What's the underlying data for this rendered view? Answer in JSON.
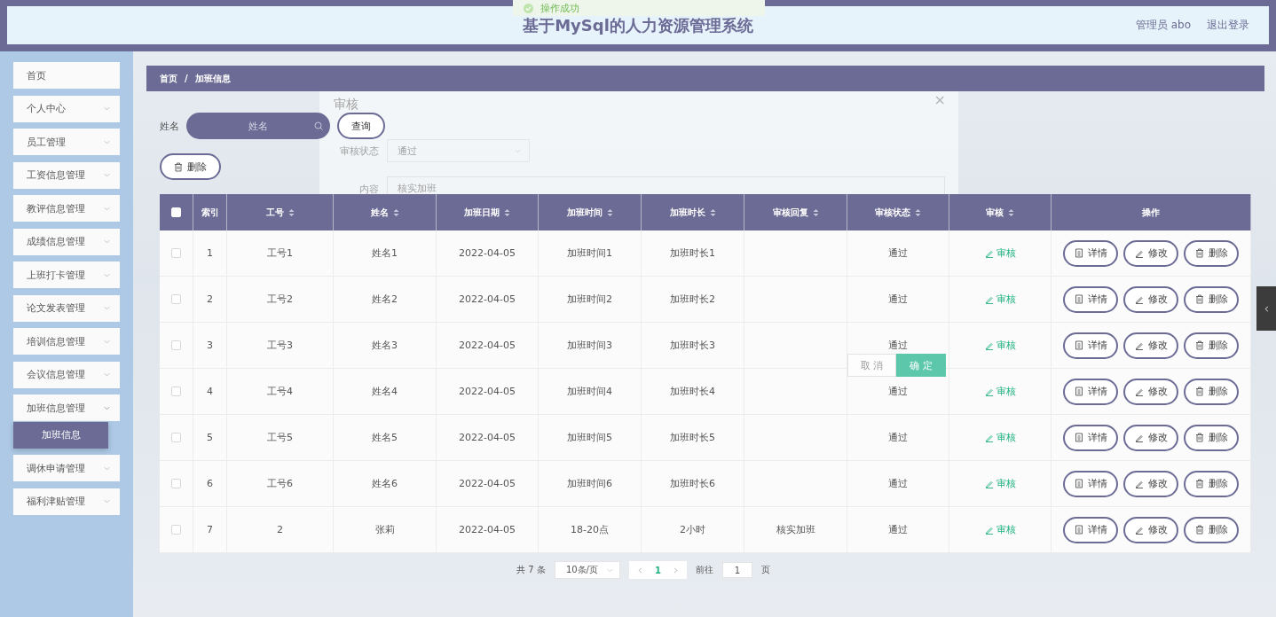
{
  "header": {
    "title": "基于MySql的人力资源管理系统",
    "user": "管理员 abo",
    "logout": "退出登录"
  },
  "toast": {
    "text": "操作成功"
  },
  "sidebar": {
    "items": [
      {
        "label": "首页",
        "expandable": false
      },
      {
        "label": "个人中心",
        "expandable": true,
        "expanded": false
      },
      {
        "label": "员工管理",
        "expandable": true,
        "expanded": false
      },
      {
        "label": "工资信息管理",
        "expandable": true,
        "expanded": false
      },
      {
        "label": "教评信息管理",
        "expandable": true,
        "expanded": false
      },
      {
        "label": "成绩信息管理",
        "expandable": true,
        "expanded": false
      },
      {
        "label": "上班打卡管理",
        "expandable": true,
        "expanded": false
      },
      {
        "label": "论文发表管理",
        "expandable": true,
        "expanded": false
      },
      {
        "label": "培训信息管理",
        "expandable": true,
        "expanded": false
      },
      {
        "label": "会议信息管理",
        "expandable": true,
        "expanded": false
      },
      {
        "label": "加班信息管理",
        "expandable": true,
        "expanded": true,
        "children": [
          {
            "label": "加班信息",
            "selected": true
          }
        ]
      },
      {
        "label": "调休申请管理",
        "expandable": true,
        "expanded": false
      },
      {
        "label": "福利津贴管理",
        "expandable": true,
        "expanded": false
      }
    ]
  },
  "breadcrumb": [
    "首页",
    "/",
    "加班信息"
  ],
  "search": {
    "label": "姓名",
    "placeholder": "姓名",
    "button": "查询"
  },
  "delete_button": "删除",
  "table": {
    "select_all": {
      "checked": false
    },
    "columns": [
      {
        "label": "索引",
        "sortable": false
      },
      {
        "label": "工号",
        "sortable": true
      },
      {
        "label": "姓名",
        "sortable": true
      },
      {
        "label": "加班日期",
        "sortable": true
      },
      {
        "label": "加班时间",
        "sortable": true
      },
      {
        "label": "加班时长",
        "sortable": true
      },
      {
        "label": "审核回复",
        "sortable": true
      },
      {
        "label": "审核状态",
        "sortable": true
      },
      {
        "label": "审核",
        "sortable": true
      },
      {
        "label": "操作",
        "sortable": false
      }
    ],
    "rows": [
      {
        "checked": false,
        "cells": [
          "1",
          "工号1",
          "姓名1",
          "2022-04-05",
          "加班时间1",
          "加班时长1",
          "",
          "通过"
        ],
        "review": "审核",
        "actions": [
          "详情",
          "修改",
          "删除"
        ]
      },
      {
        "checked": false,
        "cells": [
          "2",
          "工号2",
          "姓名2",
          "2022-04-05",
          "加班时间2",
          "加班时长2",
          "",
          "通过"
        ],
        "review": "审核",
        "actions": [
          "详情",
          "修改",
          "删除"
        ]
      },
      {
        "checked": false,
        "cells": [
          "3",
          "工号3",
          "姓名3",
          "2022-04-05",
          "加班时间3",
          "加班时长3",
          "",
          "通过"
        ],
        "review": "审核",
        "actions": [
          "详情",
          "修改",
          "删除"
        ]
      },
      {
        "checked": false,
        "cells": [
          "4",
          "工号4",
          "姓名4",
          "2022-04-05",
          "加班时间4",
          "加班时长4",
          "",
          "通过"
        ],
        "review": "审核",
        "actions": [
          "详情",
          "修改",
          "删除"
        ]
      },
      {
        "checked": false,
        "cells": [
          "5",
          "工号5",
          "姓名5",
          "2022-04-05",
          "加班时间5",
          "加班时长5",
          "",
          "通过"
        ],
        "review": "审核",
        "actions": [
          "详情",
          "修改",
          "删除"
        ]
      },
      {
        "checked": false,
        "cells": [
          "6",
          "工号6",
          "姓名6",
          "2022-04-05",
          "加班时间6",
          "加班时长6",
          "",
          "通过"
        ],
        "review": "审核",
        "actions": [
          "详情",
          "修改",
          "删除"
        ]
      },
      {
        "checked": false,
        "cells": [
          "7",
          "2",
          "张莉",
          "2022-04-05",
          "18-20点",
          "2小时",
          "核实加班",
          "通过"
        ],
        "review": "审核",
        "actions": [
          "详情",
          "修改",
          "删除"
        ]
      }
    ]
  },
  "pagination": {
    "total": "共 7 条",
    "page_size": "10条/页",
    "pages": [
      {
        "label": "1",
        "selected": true
      }
    ],
    "goto_label": "前往",
    "goto_value": "1",
    "goto_suffix": "页"
  },
  "dialog": {
    "title": "审核",
    "close": "×",
    "status_label": "审核状态",
    "status_value": "通过",
    "content_label": "内容",
    "content_value": "核实加班",
    "cancel": "取 消",
    "confirm": "确 定"
  }
}
